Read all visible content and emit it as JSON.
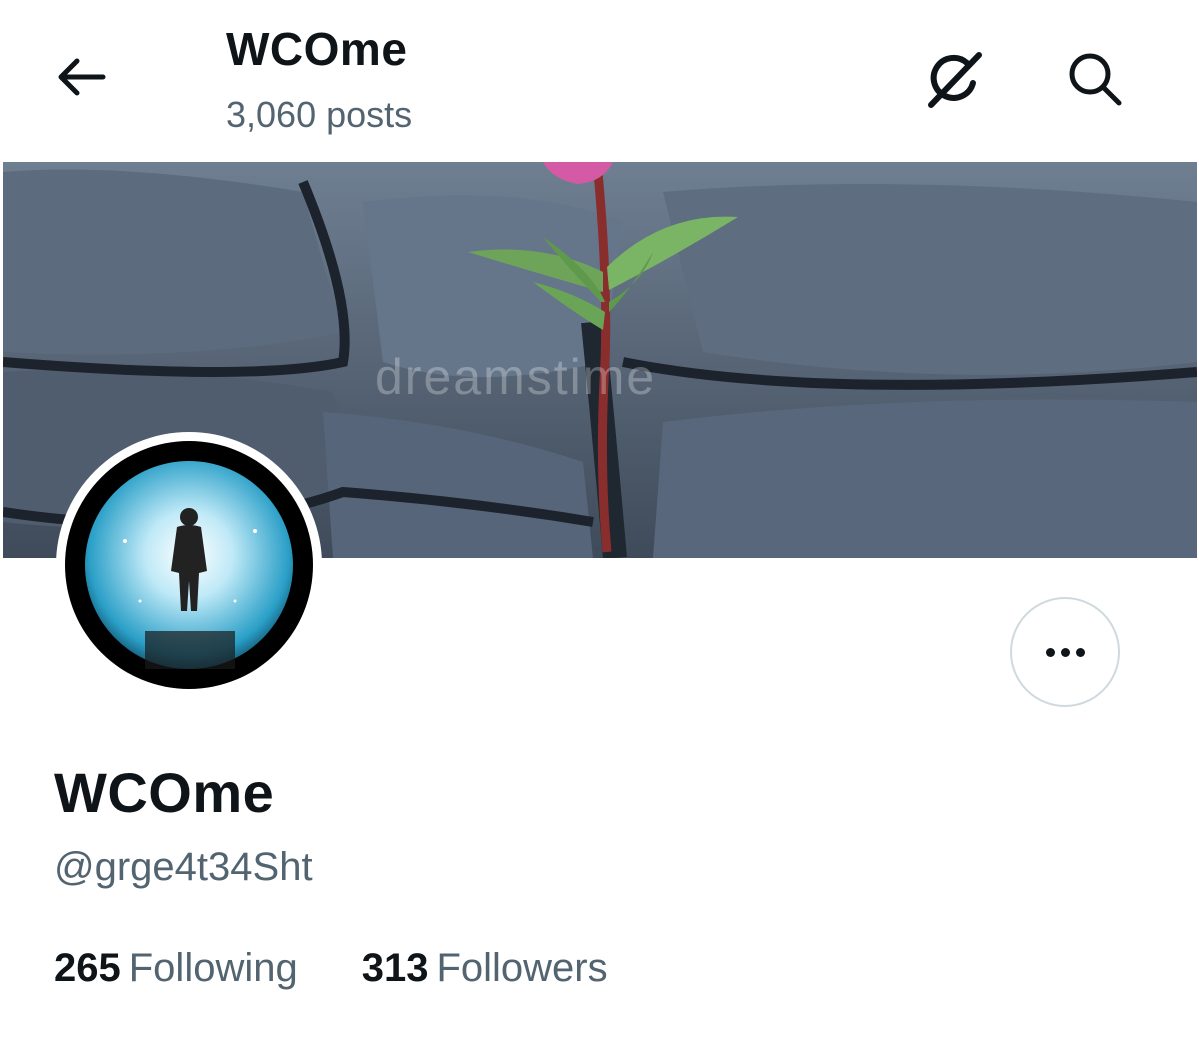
{
  "header": {
    "title": "WCOme",
    "posts_count": "3,060 posts",
    "back_icon": "arrow-left-icon",
    "grok_icon": "grok-icon",
    "search_icon": "search-icon"
  },
  "banner": {
    "watermark": "dreamstime",
    "description_icon": "banner-image"
  },
  "profile": {
    "display_name": "WCOme",
    "handle": "@grge4t34Sht",
    "following_count": "265",
    "following_label": "Following",
    "followers_count": "313",
    "followers_label": "Followers"
  },
  "colors": {
    "text_primary": "#0f1419",
    "text_secondary": "#536471",
    "border": "#cfd9de"
  }
}
